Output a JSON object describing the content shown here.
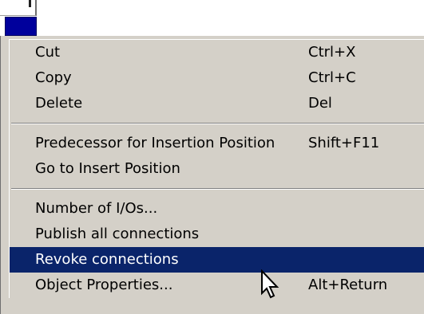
{
  "menu": {
    "groups": [
      [
        {
          "label": "Cut",
          "accel": "Ctrl+X"
        },
        {
          "label": "Copy",
          "accel": "Ctrl+C"
        },
        {
          "label": "Delete",
          "accel": "Del"
        }
      ],
      [
        {
          "label": "Predecessor for Insertion Position",
          "accel": "Shift+F11"
        },
        {
          "label": "Go to Insert Position",
          "accel": ""
        }
      ],
      [
        {
          "label": "Number of I/Os...",
          "accel": ""
        },
        {
          "label": "Publish all connections",
          "accel": ""
        },
        {
          "label": "Revoke connections",
          "accel": "",
          "selected": true
        },
        {
          "label": "Object Properties...",
          "accel": "Alt+Return"
        }
      ]
    ]
  },
  "colors": {
    "menu_bg": "#d4d0c8",
    "highlight": "#0a246a",
    "toolbar_blue": "#00009c"
  },
  "icons": {
    "cursor": "arrow-cursor-icon"
  }
}
